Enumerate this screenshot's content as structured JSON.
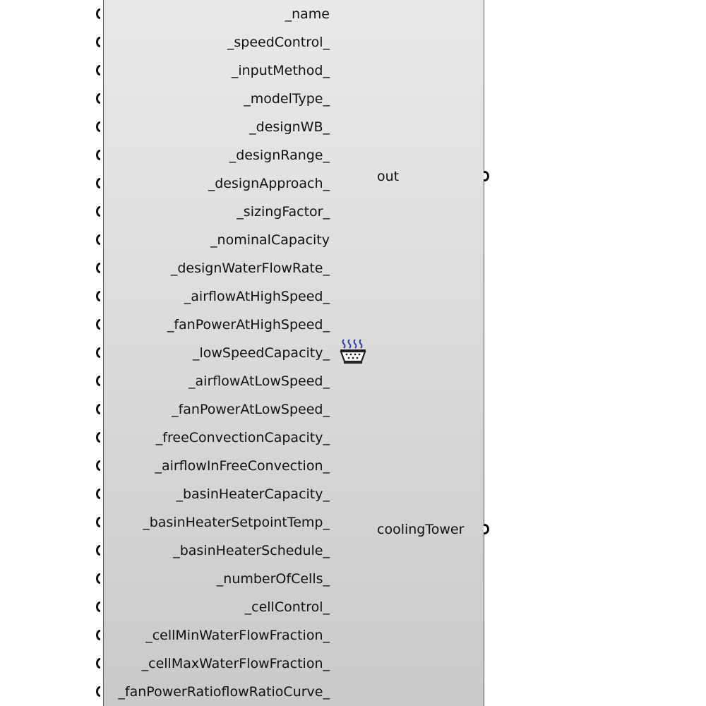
{
  "component": {
    "inputs": [
      "_name",
      "_speedControl_",
      "_inputMethod_",
      "_modelType_",
      "_designWB_",
      "_designRange_",
      "_designApproach_",
      "_sizingFactor_",
      "_nominalCapacity",
      "_designWaterFlowRate_",
      "_airflowAtHighSpeed_",
      "_fanPowerAtHighSpeed_",
      "_lowSpeedCapacity_",
      "_airflowAtLowSpeed_",
      "_fanPowerAtLowSpeed_",
      "_freeConvectionCapacity_",
      "_airflowInFreeConvection_",
      "_basinHeaterCapacity_",
      "_basinHeaterSetpointTemp_",
      "_basinHeaterSchedule_",
      "_numberOfCells_",
      "_cellControl_",
      "_cellMinWaterFlowFraction_",
      "_cellMaxWaterFlowFraction_",
      "_fanPowerRatioflowRatioCurve_"
    ],
    "outputs": [
      "out",
      "coolingTower"
    ],
    "icon": "cooling-tower-icon",
    "colors": {
      "body_top": "#e9e9e9",
      "body_bottom": "#c9c9c9",
      "border": "#5a5a5a",
      "icon_steam": "#2e3fa8"
    }
  }
}
